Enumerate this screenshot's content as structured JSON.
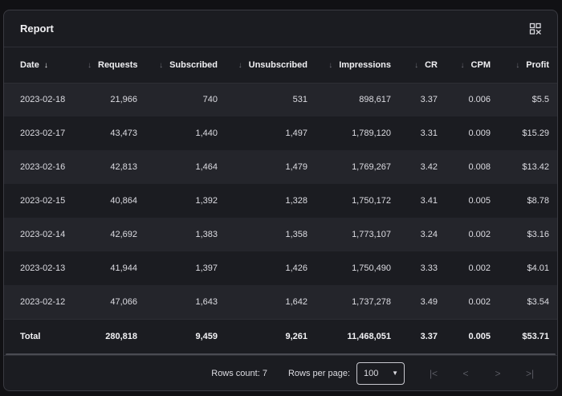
{
  "report": {
    "title": "Report",
    "columns_icon": "columns-settings-icon",
    "columns": [
      {
        "label": "Date",
        "sort_icon": "arrow-down-icon"
      },
      {
        "label": "Requests",
        "sort_icon": "arrow-down-icon"
      },
      {
        "label": "Subscribed",
        "sort_icon": "arrow-down-icon"
      },
      {
        "label": "Unsubscribed",
        "sort_icon": "arrow-down-icon"
      },
      {
        "label": "Impressions",
        "sort_icon": "arrow-down-icon"
      },
      {
        "label": "CR",
        "sort_icon": "arrow-down-icon"
      },
      {
        "label": "CPM",
        "sort_icon": "arrow-down-icon"
      },
      {
        "label": "Profit",
        "sort_icon": "arrow-down-icon"
      }
    ],
    "rows": [
      [
        "2023-02-18",
        "21,966",
        "740",
        "531",
        "898,617",
        "3.37",
        "0.006",
        "$5.5"
      ],
      [
        "2023-02-17",
        "43,473",
        "1,440",
        "1,497",
        "1,789,120",
        "3.31",
        "0.009",
        "$15.29"
      ],
      [
        "2023-02-16",
        "42,813",
        "1,464",
        "1,479",
        "1,769,267",
        "3.42",
        "0.008",
        "$13.42"
      ],
      [
        "2023-02-15",
        "40,864",
        "1,392",
        "1,328",
        "1,750,172",
        "3.41",
        "0.005",
        "$8.78"
      ],
      [
        "2023-02-14",
        "42,692",
        "1,383",
        "1,358",
        "1,773,107",
        "3.24",
        "0.002",
        "$3.16"
      ],
      [
        "2023-02-13",
        "41,944",
        "1,397",
        "1,426",
        "1,750,490",
        "3.33",
        "0.002",
        "$4.01"
      ],
      [
        "2023-02-12",
        "47,066",
        "1,643",
        "1,642",
        "1,737,278",
        "3.49",
        "0.002",
        "$3.54"
      ]
    ],
    "total": [
      "Total",
      "280,818",
      "9,459",
      "9,261",
      "11,468,051",
      "3.37",
      "0.005",
      "$53.71"
    ]
  },
  "footer": {
    "rows_count": "Rows count: 7",
    "rows_per_page_label": "Rows per page:",
    "rows_per_page_value": "100",
    "pager_icons": [
      "first-page-icon",
      "prev-page-icon",
      "next-page-icon",
      "last-page-icon"
    ]
  },
  "colors": {
    "background": "#111114",
    "card": "#1b1c21",
    "row_alt": "#24252b",
    "border": "#3a3b42",
    "text": "#e6e6ea",
    "muted_icon": "#6c6d75"
  }
}
